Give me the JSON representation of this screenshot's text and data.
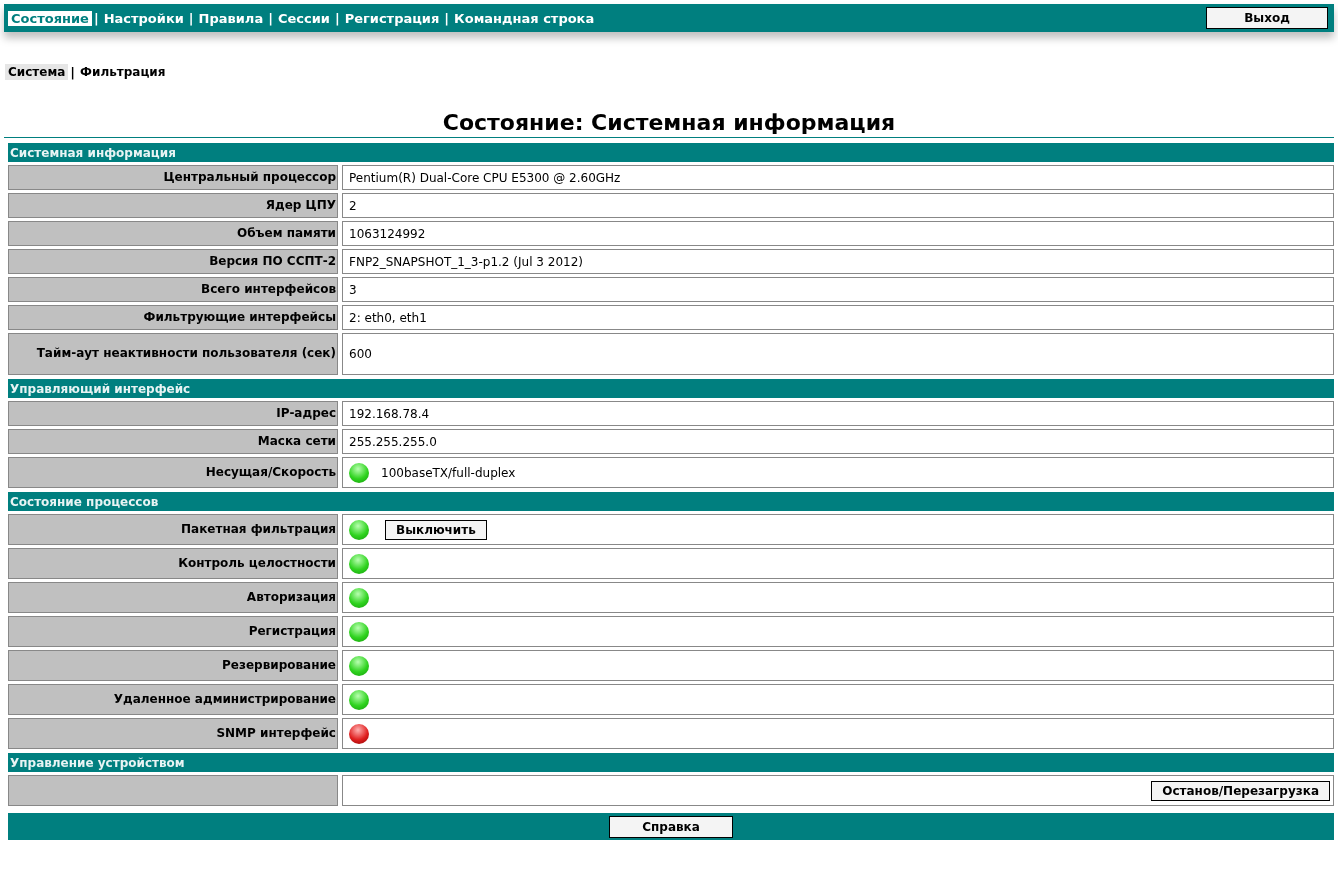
{
  "nav": {
    "separator": "|",
    "tabs": [
      {
        "label": "Состояние",
        "selected": true
      },
      {
        "label": "Настройки",
        "selected": false
      },
      {
        "label": "Правила",
        "selected": false
      },
      {
        "label": "Сессии",
        "selected": false
      },
      {
        "label": "Регистрация",
        "selected": false
      },
      {
        "label": "Командная строка",
        "selected": false
      }
    ],
    "logout": "Выход"
  },
  "subnav": {
    "separator": "|",
    "tabs": [
      {
        "label": "Система",
        "selected": true
      },
      {
        "label": "Фильтрация",
        "selected": false
      }
    ]
  },
  "title": "Состояние: Системная информация",
  "sections": [
    {
      "title": "Системная информация",
      "rows": [
        {
          "kind": "text",
          "label": "Центральный процессор",
          "value": "Pentium(R) Dual-Core CPU E5300 @ 2.60GHz"
        },
        {
          "kind": "text",
          "label": "Ядер ЦПУ",
          "value": "2"
        },
        {
          "kind": "text",
          "label": "Объем памяти",
          "value": "1063124992"
        },
        {
          "kind": "text",
          "label": "Версия ПО ССПТ-2",
          "value": "FNP2_SNAPSHOT_1_3-p1.2 (Jul 3 2012)"
        },
        {
          "kind": "text",
          "label": "Всего интерфейсов",
          "value": "3"
        },
        {
          "kind": "text",
          "label": "Фильтрующие интерфейсы",
          "value": "2: eth0, eth1"
        },
        {
          "kind": "text",
          "label": "Тайм-аут неактивности пользователя (сек)",
          "value": "600"
        }
      ]
    },
    {
      "title": "Управляющий интерфейс",
      "rows": [
        {
          "kind": "text",
          "label": "IP-адрес",
          "value": "192.168.78.4"
        },
        {
          "kind": "text",
          "label": "Маска сети",
          "value": "255.255.255.0"
        },
        {
          "kind": "status",
          "label": "Несущая/Скорость",
          "on": true,
          "value": "100baseTX/full-duplex"
        }
      ]
    },
    {
      "title": "Состояние процессов",
      "rows": [
        {
          "kind": "status",
          "label": "Пакетная фильтрация",
          "on": true,
          "button": "Выключить"
        },
        {
          "kind": "status",
          "label": "Контроль целостности",
          "on": true
        },
        {
          "kind": "status",
          "label": "Авторизация",
          "on": true
        },
        {
          "kind": "status",
          "label": "Регистрация",
          "on": true
        },
        {
          "kind": "status",
          "label": "Резервирование",
          "on": true
        },
        {
          "kind": "status",
          "label": "Удаленное администрирование",
          "on": true
        },
        {
          "kind": "status",
          "label": "SNMP интерфейс",
          "on": false
        }
      ]
    },
    {
      "title": "Управление устройством",
      "rows": [
        {
          "kind": "action",
          "button": "Останов/Перезагрузка"
        }
      ]
    }
  ],
  "help": "Справка"
}
